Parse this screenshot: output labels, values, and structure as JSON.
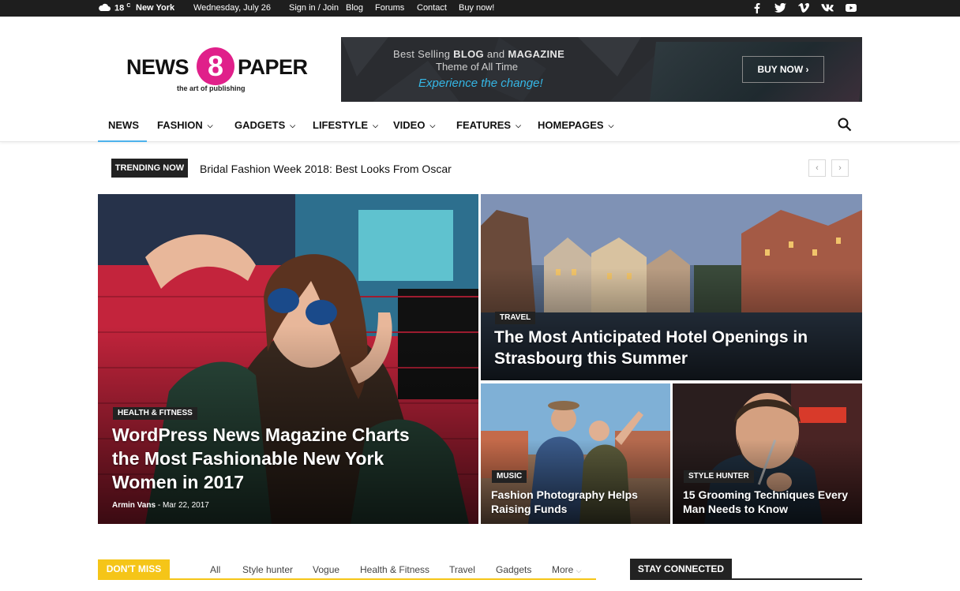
{
  "topbar": {
    "temperature": "18",
    "temp_unit": "C",
    "city": "New York",
    "date": "Wednesday, July 26",
    "links": [
      "Sign in / Join",
      "Blog",
      "Forums",
      "Contact",
      "Buy now!"
    ],
    "social": [
      "facebook-icon",
      "twitter-icon",
      "vimeo-icon",
      "vk-icon",
      "youtube-icon"
    ]
  },
  "logo": {
    "left": "NEWS",
    "number": "8",
    "right": "PAPER",
    "tagline": "the art of publishing",
    "accent_color": "#e0208a"
  },
  "banner": {
    "line1_normal1": "Best Selling ",
    "line1_bold1": "BLOG",
    "line1_normal2": " and ",
    "line1_bold2": "MAGAZINE",
    "line2": "Theme of All Time",
    "line3": "Experience the change!",
    "button": "BUY NOW ›"
  },
  "nav": {
    "items": [
      "NEWS",
      "FASHION",
      "GADGETS",
      "LIFESTYLE",
      "VIDEO",
      "FEATURES",
      "HOMEPAGES"
    ],
    "active": "NEWS",
    "accent_color": "#4db2ec"
  },
  "trending": {
    "label": "TRENDING NOW",
    "headline": "Bridal Fashion Week 2018: Best Looks From Oscar",
    "prev": "‹",
    "next": "›"
  },
  "featured": {
    "main": {
      "category": "HEALTH & FITNESS",
      "title": "WordPress News Magazine Charts the Most Fashionable New York Women in 2017",
      "author": "Armin Vans",
      "separator": "-",
      "date": "Mar 22, 2017"
    },
    "top_right": {
      "category": "TRAVEL",
      "title": "The Most Anticipated Hotel Openings in Strasbourg this Summer"
    },
    "bottom_left": {
      "category": "MUSIC",
      "title": "Fashion Photography Helps Raising Funds"
    },
    "bottom_right": {
      "category": "STYLE HUNTER",
      "title": "15 Grooming Techniques Every Man Needs to Know"
    }
  },
  "dont_miss": {
    "label": "DON'T MISS",
    "tabs": [
      "All",
      "Style hunter",
      "Vogue",
      "Health & Fitness",
      "Travel",
      "Gadgets",
      "More"
    ],
    "accent_color": "#f5c518"
  },
  "stay_connected": {
    "label": "STAY CONNECTED"
  }
}
